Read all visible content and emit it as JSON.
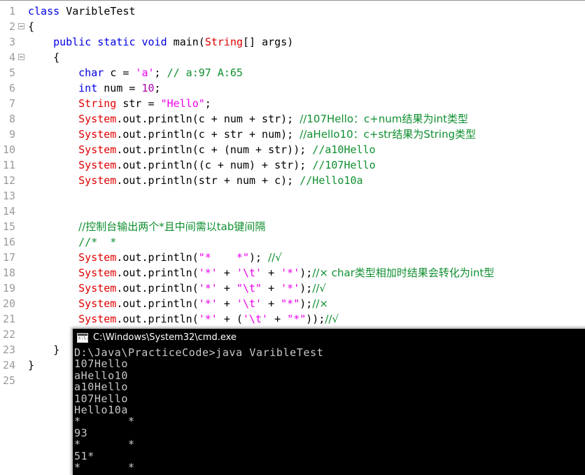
{
  "editor": {
    "total_lines": 25,
    "lines": [
      {
        "n": 1,
        "fold": false,
        "indent": 0,
        "tokens": [
          {
            "t": "class ",
            "c": "kw"
          },
          {
            "t": "VaribleTest",
            "c": "plain"
          }
        ]
      },
      {
        "n": 2,
        "fold": true,
        "indent": 0,
        "tokens": [
          {
            "t": "{",
            "c": "plain"
          }
        ]
      },
      {
        "n": 3,
        "fold": false,
        "indent": 4,
        "tokens": [
          {
            "t": "public ",
            "c": "kw"
          },
          {
            "t": "static ",
            "c": "kw"
          },
          {
            "t": "void ",
            "c": "kw"
          },
          {
            "t": "main(",
            "c": "plain"
          },
          {
            "t": "String",
            "c": "type"
          },
          {
            "t": "[] args)",
            "c": "plain"
          }
        ]
      },
      {
        "n": 4,
        "fold": true,
        "indent": 4,
        "tokens": [
          {
            "t": "{",
            "c": "plain"
          }
        ]
      },
      {
        "n": 5,
        "fold": false,
        "indent": 8,
        "tokens": [
          {
            "t": "char ",
            "c": "kw"
          },
          {
            "t": "c = ",
            "c": "plain"
          },
          {
            "t": "'a'",
            "c": "str"
          },
          {
            "t": "; ",
            "c": "plain"
          },
          {
            "t": "// a:97 A:65",
            "c": "cmt"
          }
        ]
      },
      {
        "n": 6,
        "fold": false,
        "indent": 8,
        "tokens": [
          {
            "t": "int ",
            "c": "kw"
          },
          {
            "t": "num = ",
            "c": "plain"
          },
          {
            "t": "10",
            "c": "num"
          },
          {
            "t": ";",
            "c": "plain"
          }
        ]
      },
      {
        "n": 7,
        "fold": false,
        "indent": 8,
        "tokens": [
          {
            "t": "String",
            "c": "type"
          },
          {
            "t": " str = ",
            "c": "plain"
          },
          {
            "t": "\"Hello\"",
            "c": "str"
          },
          {
            "t": ";",
            "c": "plain"
          }
        ]
      },
      {
        "n": 8,
        "fold": false,
        "indent": 8,
        "tokens": [
          {
            "t": "System",
            "c": "type"
          },
          {
            "t": ".out.println(c + num + str); ",
            "c": "plain"
          },
          {
            "t": "//107Hello：c+num结果为int类型",
            "c": "cmt"
          }
        ]
      },
      {
        "n": 9,
        "fold": false,
        "indent": 8,
        "tokens": [
          {
            "t": "System",
            "c": "type"
          },
          {
            "t": ".out.println(c + str + num); ",
            "c": "plain"
          },
          {
            "t": "//aHello10：c+str结果为String类型",
            "c": "cmt"
          }
        ]
      },
      {
        "n": 10,
        "fold": false,
        "indent": 8,
        "tokens": [
          {
            "t": "System",
            "c": "type"
          },
          {
            "t": ".out.println(c + (num + str)); ",
            "c": "plain"
          },
          {
            "t": "//a10Hello",
            "c": "cmt"
          }
        ]
      },
      {
        "n": 11,
        "fold": false,
        "indent": 8,
        "tokens": [
          {
            "t": "System",
            "c": "type"
          },
          {
            "t": ".out.println((c + num) + str); ",
            "c": "plain"
          },
          {
            "t": "//107Hello",
            "c": "cmt"
          }
        ]
      },
      {
        "n": 12,
        "fold": false,
        "indent": 8,
        "tokens": [
          {
            "t": "System",
            "c": "type"
          },
          {
            "t": ".out.println(str + num + c); ",
            "c": "plain"
          },
          {
            "t": "//Hello10a",
            "c": "cmt"
          }
        ]
      },
      {
        "n": 13,
        "fold": false,
        "indent": 0,
        "tokens": []
      },
      {
        "n": 14,
        "fold": false,
        "indent": 0,
        "tokens": []
      },
      {
        "n": 15,
        "fold": false,
        "indent": 8,
        "tokens": [
          {
            "t": "//控制台输出两个*且中间需以tab键间隔",
            "c": "cmt"
          }
        ]
      },
      {
        "n": 16,
        "fold": false,
        "indent": 8,
        "tokens": [
          {
            "t": "//*  *",
            "c": "cmt"
          }
        ]
      },
      {
        "n": 17,
        "fold": false,
        "indent": 8,
        "tokens": [
          {
            "t": "System",
            "c": "type"
          },
          {
            "t": ".out.println(",
            "c": "plain"
          },
          {
            "t": "\"*    *\"",
            "c": "str"
          },
          {
            "t": "); ",
            "c": "plain"
          },
          {
            "t": "//√",
            "c": "cmt"
          }
        ]
      },
      {
        "n": 18,
        "fold": false,
        "indent": 8,
        "tokens": [
          {
            "t": "System",
            "c": "type"
          },
          {
            "t": ".out.println(",
            "c": "plain"
          },
          {
            "t": "'*'",
            "c": "str"
          },
          {
            "t": " + ",
            "c": "plain"
          },
          {
            "t": "'\\t'",
            "c": "str"
          },
          {
            "t": " + ",
            "c": "plain"
          },
          {
            "t": "'*'",
            "c": "str"
          },
          {
            "t": ");",
            "c": "plain"
          },
          {
            "t": "//× char类型相加时结果会转化为int型",
            "c": "cmt"
          }
        ]
      },
      {
        "n": 19,
        "fold": false,
        "indent": 8,
        "tokens": [
          {
            "t": "System",
            "c": "type"
          },
          {
            "t": ".out.println(",
            "c": "plain"
          },
          {
            "t": "'*'",
            "c": "str"
          },
          {
            "t": " + ",
            "c": "plain"
          },
          {
            "t": "\"\\t\"",
            "c": "str"
          },
          {
            "t": " + ",
            "c": "plain"
          },
          {
            "t": "'*'",
            "c": "str"
          },
          {
            "t": ");",
            "c": "plain"
          },
          {
            "t": "//√",
            "c": "cmt"
          }
        ]
      },
      {
        "n": 20,
        "fold": false,
        "indent": 8,
        "tokens": [
          {
            "t": "System",
            "c": "type"
          },
          {
            "t": ".out.println(",
            "c": "plain"
          },
          {
            "t": "'*'",
            "c": "str"
          },
          {
            "t": " + ",
            "c": "plain"
          },
          {
            "t": "'\\t'",
            "c": "str"
          },
          {
            "t": " + ",
            "c": "plain"
          },
          {
            "t": "\"*\"",
            "c": "str"
          },
          {
            "t": ");",
            "c": "plain"
          },
          {
            "t": "//×",
            "c": "cmt"
          }
        ]
      },
      {
        "n": 21,
        "fold": false,
        "indent": 8,
        "tokens": [
          {
            "t": "System",
            "c": "type"
          },
          {
            "t": ".out.println(",
            "c": "plain"
          },
          {
            "t": "'*'",
            "c": "str"
          },
          {
            "t": " + (",
            "c": "plain"
          },
          {
            "t": "'\\t'",
            "c": "str"
          },
          {
            "t": " + ",
            "c": "plain"
          },
          {
            "t": "\"*\"",
            "c": "str"
          },
          {
            "t": "));",
            "c": "plain"
          },
          {
            "t": "//√",
            "c": "cmt"
          }
        ]
      },
      {
        "n": 22,
        "fold": false,
        "indent": 0,
        "tokens": []
      },
      {
        "n": 23,
        "fold": false,
        "indent": 4,
        "tokens": [
          {
            "t": "}",
            "c": "plain"
          }
        ]
      },
      {
        "n": 24,
        "fold": false,
        "indent": 0,
        "tokens": [
          {
            "t": "}",
            "c": "plain"
          }
        ]
      },
      {
        "n": 25,
        "fold": false,
        "indent": 0,
        "tokens": []
      }
    ]
  },
  "console": {
    "title": "C:\\Windows\\System32\\cmd.exe",
    "icon": "cmd-icon",
    "prompt_line": "D:\\Java\\PracticeCode>java VaribleTest",
    "output": [
      "107Hello",
      "aHello10",
      "a10Hello",
      "107Hello",
      "Hello10a",
      "*       *",
      "93",
      "*       *",
      "51*",
      "*       *"
    ]
  },
  "colors": {
    "keyword": "#0000e6",
    "type": "#e00000",
    "string": "#ee00ee",
    "number": "#aa00aa",
    "comment": "#0f8f2f",
    "gutter": "#9a9a9a",
    "console_bg": "#000000",
    "console_fg": "#c8c8c8",
    "editor_bg": "#ffffff"
  }
}
